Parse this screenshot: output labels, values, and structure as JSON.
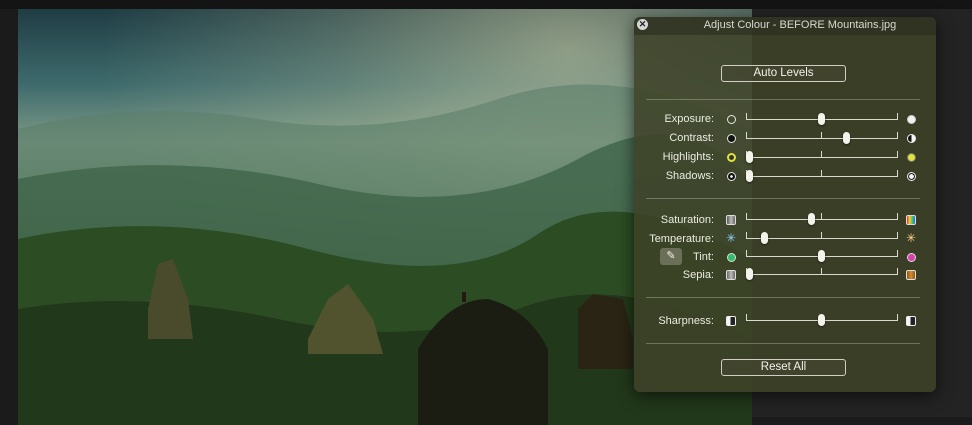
{
  "window": {
    "title": "Adjust Colour - BEFORE Mountains.jpg"
  },
  "buttons": {
    "auto_levels": "Auto Levels",
    "reset_all": "Reset All"
  },
  "sliders": [
    {
      "label": "Exposure:",
      "value": 0.5,
      "left_icon": "aperture-dark-icon",
      "right_icon": "aperture-light-icon"
    },
    {
      "label": "Contrast:",
      "value": 0.66,
      "left_icon": "contrast-low-icon",
      "right_icon": "contrast-high-icon"
    },
    {
      "label": "Highlights:",
      "value": 0.0,
      "left_icon": "highlights-low-icon",
      "right_icon": "highlights-high-icon"
    },
    {
      "label": "Shadows:",
      "value": 0.0,
      "left_icon": "shadows-low-icon",
      "right_icon": "shadows-high-icon"
    },
    {
      "label": "Saturation:",
      "value": 0.43,
      "left_icon": "saturation-low-icon",
      "right_icon": "saturation-high-icon"
    },
    {
      "label": "Temperature:",
      "value": 0.12,
      "left_icon": "temperature-cool-icon",
      "right_icon": "temperature-warm-icon"
    },
    {
      "label": "Tint:",
      "value": 0.5,
      "left_icon": "tint-green-icon",
      "right_icon": "tint-magenta-icon"
    },
    {
      "label": "Sepia:",
      "value": 0.0,
      "left_icon": "sepia-low-icon",
      "right_icon": "sepia-high-icon"
    },
    {
      "label": "Sharpness:",
      "value": 0.5,
      "left_icon": "sharpness-low-icon",
      "right_icon": "sharpness-high-icon"
    }
  ],
  "colors": {
    "highlight_yellow": "#e3e33a",
    "tint_green": "#2fbf6a",
    "tint_magenta": "#d63fb0",
    "sepia_orange": "#d98b22"
  }
}
